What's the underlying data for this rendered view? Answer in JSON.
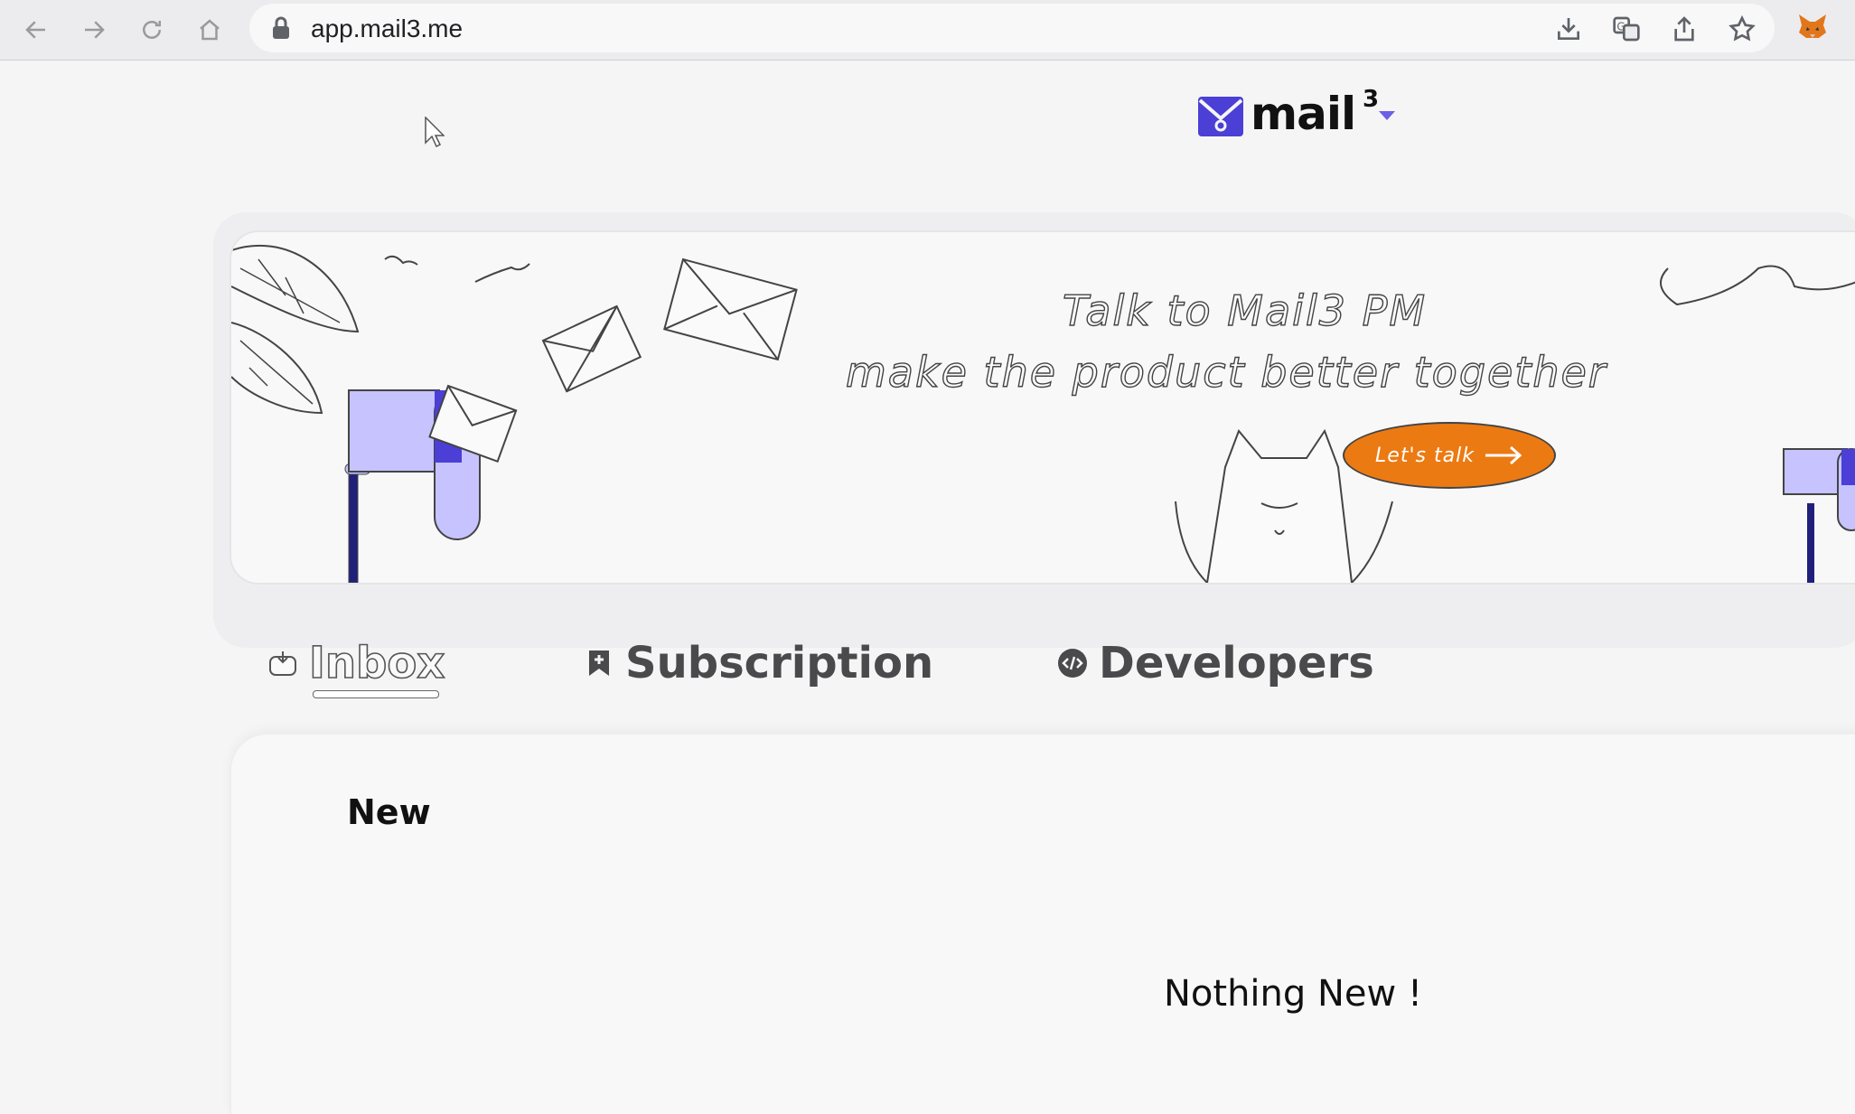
{
  "browser": {
    "url": "app.mail3.me",
    "icons": [
      "back-icon",
      "forward-icon",
      "reload-icon",
      "home-icon",
      "lock-icon",
      "install-icon",
      "translate-icon",
      "share-icon",
      "bookmark-star-icon",
      "metamask-fox-icon"
    ]
  },
  "header": {
    "logo_text": "mail",
    "logo_sup": "3"
  },
  "banner": {
    "line1": "Talk to Mail3 PM",
    "line2": "make the product better together",
    "cta_label": "Let's talk"
  },
  "tabs": [
    {
      "label": "Inbox",
      "icon": "inbox-icon",
      "active": true
    },
    {
      "label": "Subscription",
      "icon": "bookmark-icon",
      "active": false
    },
    {
      "label": "Developers",
      "icon": "code-icon",
      "active": false
    }
  ],
  "main": {
    "section_title": "New",
    "empty_message": "Nothing New !"
  },
  "colors": {
    "brand_purple": "#4b3fd6",
    "banner_cta": "#ec7a12",
    "mailbox_fill": "#c6c3ff"
  }
}
